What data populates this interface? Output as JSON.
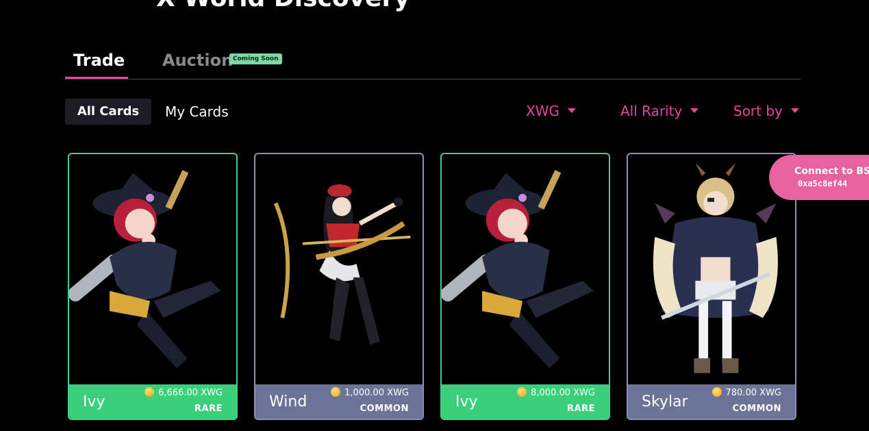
{
  "header": {
    "title": "X World Discovery"
  },
  "tabs": {
    "trade_label": "Trade",
    "auction_label": "Auction",
    "coming_soon_badge": "Coming Soon"
  },
  "subtabs": {
    "all_cards": "All Cards",
    "my_cards": "My Cards"
  },
  "filters": {
    "currency": "XWG",
    "rarity": "All Rarity",
    "sort": "Sort by"
  },
  "cards": [
    {
      "name": "Ivy",
      "price": "6,666.00 XWG",
      "rarity": "RARE",
      "art": "witch-gunner"
    },
    {
      "name": "Wind",
      "price": "1,000.00 XWG",
      "rarity": "COMMON",
      "art": "archer-girl"
    },
    {
      "name": "Ivy",
      "price": "8,000.00 XWG",
      "rarity": "RARE",
      "art": "witch-gunner"
    },
    {
      "name": "Skylar",
      "price": "780.00 XWG",
      "rarity": "COMMON",
      "art": "horned-swordsman"
    }
  ],
  "wallet": {
    "connect_label": "Connect to BSC",
    "address": "0xa5c8ef44"
  },
  "colors": {
    "accent": "#e8449a",
    "rare": "#3bcf7b",
    "common": "#6b7397"
  }
}
